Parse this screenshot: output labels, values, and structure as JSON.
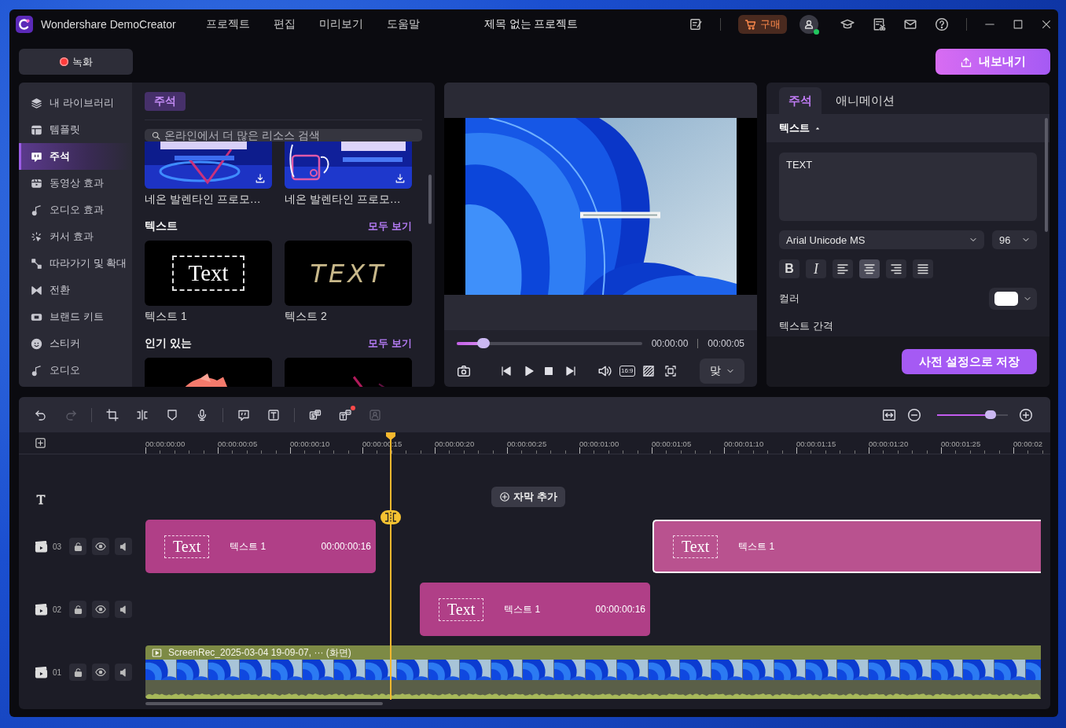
{
  "app": {
    "name": "Wondershare DemoCreator"
  },
  "menu": [
    {
      "label": "프로젝트"
    },
    {
      "label": "편집"
    },
    {
      "label": "미리보기"
    },
    {
      "label": "도움말"
    }
  ],
  "project_title": "제목 없는 프로젝트",
  "buy_button": {
    "label": "구매"
  },
  "account": {
    "online": true
  },
  "record_button": {
    "label": "녹화"
  },
  "export_button": {
    "label": "내보내기"
  },
  "sidebar": {
    "items": [
      {
        "label": "내 라이브러리",
        "selected": false
      },
      {
        "label": "템플릿",
        "selected": false
      },
      {
        "label": "주석",
        "selected": true
      },
      {
        "label": "동영상 효과",
        "selected": false
      },
      {
        "label": "오디오 효과",
        "selected": false
      },
      {
        "label": "커서 효과",
        "selected": false
      },
      {
        "label": "따라가기 및 확대",
        "selected": false
      },
      {
        "label": "전환",
        "selected": false
      },
      {
        "label": "브랜드 키트",
        "selected": false
      },
      {
        "label": "스티커",
        "selected": false
      },
      {
        "label": "오디오",
        "selected": false
      }
    ]
  },
  "library": {
    "tag": "주석",
    "search": {
      "placeholder": "온라인에서 더 많은 리소스 검색"
    },
    "templates": [
      {
        "label": "네온 발렌타인 프로모…",
        "kind": "picture"
      },
      {
        "label": "네온 발렌타인 프로모…",
        "kind": "picture"
      }
    ],
    "sections": [
      {
        "title": "텍스트",
        "more": "모두 보기",
        "items": [
          {
            "kind": "boxed",
            "preview": "Text",
            "label": "텍스트 1"
          },
          {
            "kind": "spaced",
            "preview": "TEXT",
            "label": "텍스트 2"
          }
        ]
      },
      {
        "title": "인기 있는",
        "more": "모두 보기"
      }
    ]
  },
  "preview": {
    "progress": {
      "level": 0.12
    },
    "current_time": "00:00:00",
    "duration": "00:00:05",
    "aspect_label": "16:9",
    "fit_label": "맞"
  },
  "properties": {
    "tabs": [
      {
        "label": "주석",
        "selected": true
      },
      {
        "label": "애니메이션",
        "selected": false
      }
    ],
    "section": {
      "title": "텍스트",
      "expanded": true
    },
    "text_value": "TEXT",
    "font": "Arial Unicode MS",
    "size": "96",
    "format_buttons": [
      {
        "kind": "bold",
        "label": "B",
        "selected": false
      },
      {
        "kind": "italic",
        "label": "I",
        "selected": false
      },
      {
        "kind": "align-left",
        "selected": false
      },
      {
        "kind": "align-center",
        "selected": true
      },
      {
        "kind": "align-right",
        "selected": false
      },
      {
        "kind": "justify",
        "selected": false
      }
    ],
    "color_label": "컬러",
    "color": "#ffffff",
    "spacing_label": "텍스트 간격",
    "save_button": "사전 설정으로 저장"
  },
  "timeline": {
    "tools": [
      {
        "kind": "undo",
        "disabled": false,
        "notification": false
      },
      {
        "kind": "redo",
        "disabled": true,
        "notification": false
      },
      {
        "kind": "crop",
        "disabled": false,
        "notification": false
      },
      {
        "kind": "split",
        "disabled": false,
        "notification": false
      },
      {
        "kind": "marker",
        "disabled": false,
        "notification": false
      },
      {
        "kind": "mic",
        "disabled": false,
        "notification": false
      },
      {
        "kind": "bubble",
        "disabled": false,
        "notification": false
      },
      {
        "kind": "textbox",
        "disabled": false,
        "notification": false
      },
      {
        "kind": "caption",
        "disabled": false,
        "notification": false
      },
      {
        "kind": "subtitle",
        "disabled": false,
        "notification": true
      },
      {
        "kind": "person",
        "disabled": true,
        "notification": false
      }
    ],
    "zoom": {
      "level": 0.8
    },
    "ruler": [
      "00:00:00:00",
      "00:00:00:05",
      "00:00:00:10",
      "00:00:00:15",
      "00:00:00:20",
      "00:00:00:25",
      "00:00:01:00",
      "00:00:01:05",
      "00:00:01:10",
      "00:00:01:15",
      "00:00:01:20",
      "00:00:01:25",
      "00:00:02"
    ],
    "tracks": [
      {
        "kind": "text",
        "add_button": "자막 추가"
      },
      {
        "kind": "media",
        "number": "03",
        "clips": [
          {
            "kind": "text",
            "preview": "Text",
            "label": "텍스트 1",
            "duration": "00:00:00:16",
            "selected": false
          },
          {
            "kind": "text",
            "preview": "Text",
            "label": "텍스트 1",
            "selected": true
          }
        ]
      },
      {
        "kind": "media",
        "number": "02",
        "clips": [
          {
            "kind": "text",
            "preview": "Text",
            "label": "텍스트 1",
            "duration": "00:00:00:16",
            "selected": false
          }
        ]
      },
      {
        "kind": "media",
        "number": "01",
        "clips": [
          {
            "kind": "video",
            "label": "ScreenRec_2025-03-04 19-09-07, ··· (화면)",
            "selected": false
          }
        ]
      }
    ]
  }
}
